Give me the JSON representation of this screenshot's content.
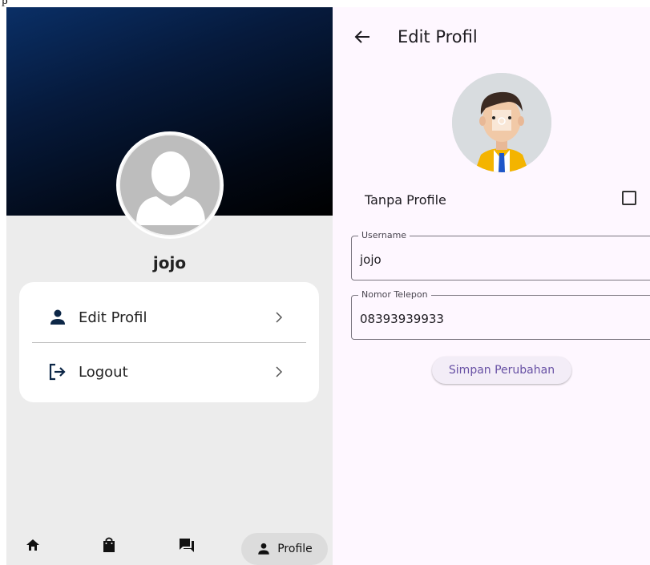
{
  "stray_char": "p",
  "profile_screen": {
    "username": "jojo",
    "menu": [
      {
        "label": "Edit Profil",
        "icon": "person-icon"
      },
      {
        "label": "Logout",
        "icon": "logout-icon"
      }
    ],
    "bottom_nav": {
      "items": [
        {
          "icon": "home-icon"
        },
        {
          "icon": "shopping-bag-icon"
        },
        {
          "icon": "forum-icon"
        }
      ],
      "active_label": "Profile",
      "active_icon": "person-icon"
    }
  },
  "edit_screen": {
    "title": "Edit Profil",
    "tanpa_profile_label": "Tanpa Profile",
    "tanpa_profile_checked": false,
    "username_label": "Username",
    "username_value": "jojo",
    "phone_label": "Nomor Telepon",
    "phone_value": "08393939933",
    "save_label": "Simpan Perubahan"
  },
  "colors": {
    "banner_dark": "#020814",
    "banner_blue": "#0a2f66",
    "accent_purple": "#6750a4",
    "screen_bg": "#fef7ff"
  }
}
